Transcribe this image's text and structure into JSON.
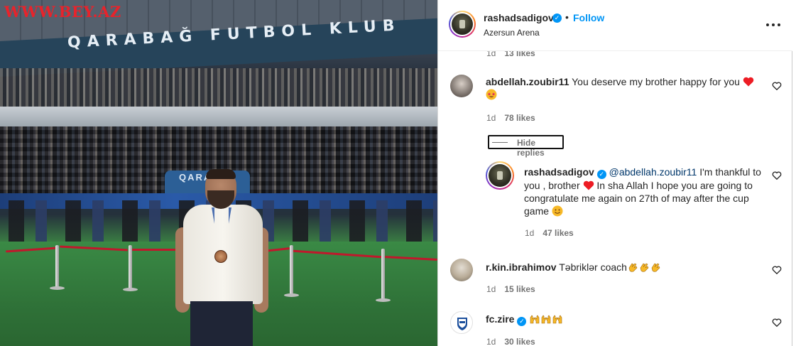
{
  "photo": {
    "watermark": "WWW.BEY.AZ",
    "stadium_sign": "QARABAĞ FUTBOL KLUB",
    "tunnel_sign": "QARABAĞ"
  },
  "post": {
    "username": "rashadsadigov",
    "separator": "•",
    "follow_label": "Follow",
    "location": "Azersun Arena"
  },
  "comments": {
    "prev_meta": {
      "time": "1d",
      "likes": "13 likes"
    },
    "c1": {
      "user": "abdellah.zoubir11",
      "text": "You deserve my brother happy for you",
      "time": "1d",
      "likes": "78 likes"
    },
    "hide_replies_label": "Hide replies",
    "c2": {
      "user": "rashadsadigov",
      "mention": "@abdellah.zoubir11",
      "text_1": " I'm thankful to you , brother ",
      "text_2": " In sha Allah I hope you are going to congratulate me again on 27th of may after the cup game ",
      "time": "1d",
      "likes": "47 likes"
    },
    "c3": {
      "user": "r.kin.ibrahimov",
      "text": "Təbriklər coach",
      "time": "1d",
      "likes": "15 likes"
    },
    "c4": {
      "user": "fc.zire",
      "text": "",
      "time": "1d",
      "likes": "30 likes"
    }
  },
  "colors": {
    "link_blue": "#0095f6",
    "mention_blue": "#00376b",
    "heart_red": "#ed1c24",
    "watermark_red": "#e8232b"
  },
  "icons": [
    "verified-badge-icon",
    "more-options-icon",
    "heart-outline-icon",
    "red-heart-emoji",
    "star-struck-emoji",
    "clapping-hands-emoji",
    "raised-hands-emoji"
  ]
}
